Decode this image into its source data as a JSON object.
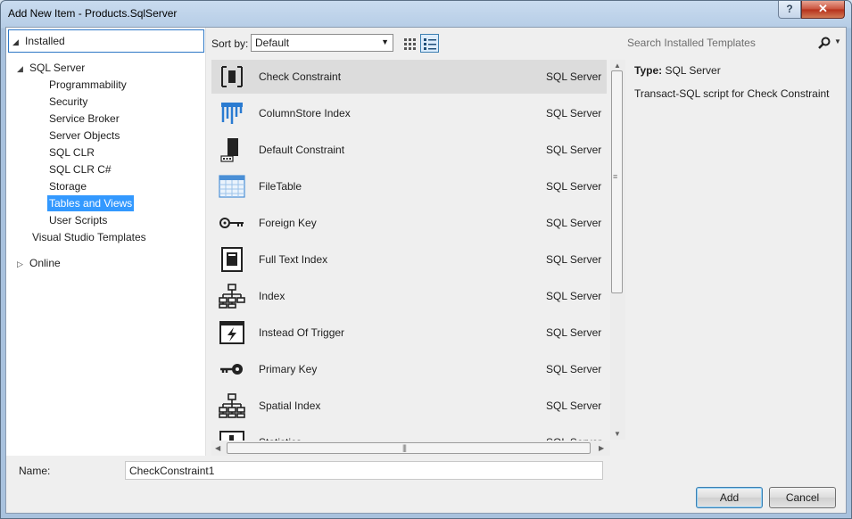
{
  "window": {
    "title": "Add New Item - Products.SqlServer",
    "help_label": "?",
    "close_label": "✕"
  },
  "tree": {
    "header": "Installed",
    "items": [
      {
        "label": "SQL Server",
        "expanded": true
      },
      {
        "label": "Programmability"
      },
      {
        "label": "Security"
      },
      {
        "label": "Service Broker"
      },
      {
        "label": "Server Objects"
      },
      {
        "label": "SQL CLR"
      },
      {
        "label": "SQL CLR C#"
      },
      {
        "label": "Storage"
      },
      {
        "label": "Tables and Views",
        "selected": true
      },
      {
        "label": "User Scripts"
      },
      {
        "label": "Visual Studio Templates"
      },
      {
        "label": "Online",
        "expanded": false
      }
    ]
  },
  "toolbar": {
    "sort_label": "Sort by:",
    "sort_value": "Default",
    "view_modes": [
      "medium-icons",
      "list-details"
    ],
    "active_view": "list-details"
  },
  "search": {
    "placeholder": "Search Installed Templates"
  },
  "templates": [
    {
      "name": "Check Constraint",
      "source": "SQL Server",
      "icon": "check-constraint-icon",
      "selected": true
    },
    {
      "name": "ColumnStore Index",
      "source": "SQL Server",
      "icon": "columnstore-index-icon"
    },
    {
      "name": "Default Constraint",
      "source": "SQL Server",
      "icon": "default-constraint-icon"
    },
    {
      "name": "FileTable",
      "source": "SQL Server",
      "icon": "filetable-icon"
    },
    {
      "name": "Foreign Key",
      "source": "SQL Server",
      "icon": "foreign-key-icon"
    },
    {
      "name": "Full Text Index",
      "source": "SQL Server",
      "icon": "full-text-index-icon"
    },
    {
      "name": "Index",
      "source": "SQL Server",
      "icon": "index-icon"
    },
    {
      "name": "Instead Of Trigger",
      "source": "SQL Server",
      "icon": "trigger-icon"
    },
    {
      "name": "Primary Key",
      "source": "SQL Server",
      "icon": "primary-key-icon"
    },
    {
      "name": "Spatial Index",
      "source": "SQL Server",
      "icon": "spatial-index-icon"
    },
    {
      "name": "Statistics",
      "source": "SQL Server",
      "icon": "statistics-icon"
    }
  ],
  "details": {
    "type_key": "Type:",
    "type_value": "SQL Server",
    "description": "Transact-SQL script for Check Constraint"
  },
  "footer": {
    "name_label": "Name:",
    "name_value": "CheckConstraint1",
    "add_label": "Add",
    "cancel_label": "Cancel"
  }
}
